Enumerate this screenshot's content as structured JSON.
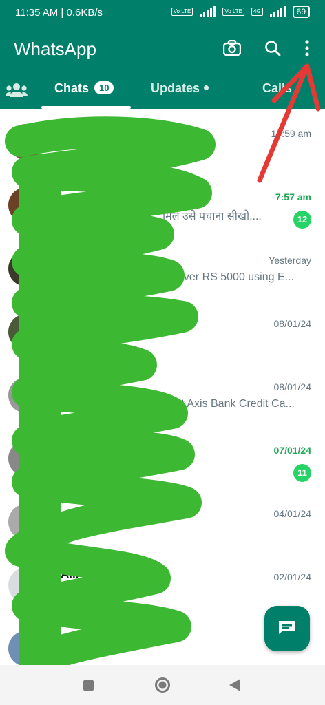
{
  "status_bar": {
    "time_speed": "11:35 AM | 0.6KB/s",
    "battery": "69",
    "net_tag_1": "Vo LTE",
    "net_tag_2": "Vo LTE",
    "net_4g": "4G"
  },
  "header": {
    "title": "WhatsApp"
  },
  "tabs": [
    {
      "label": "Chats",
      "count": "10"
    },
    {
      "label": "Updates"
    },
    {
      "label": "Calls"
    }
  ],
  "chats": [
    {
      "time": "10:59 am",
      "preview": "",
      "name": "",
      "unread": ""
    },
    {
      "time": "7:57 am",
      "preview": "मिले उसे पचाना सीखो,...",
      "unread": "12"
    },
    {
      "time": "Yesterday",
      "preview": "over RS 5000 using E...",
      "unread": ""
    },
    {
      "time": "08/01/24",
      "preview": "",
      "unread": ""
    },
    {
      "time": "08/01/24",
      "preview": "rt Axis Bank Credit Ca...",
      "unread": ""
    },
    {
      "time": "07/01/24",
      "preview": "",
      "unread": "11"
    },
    {
      "time": "04/01/24",
      "preview": "",
      "unread": ""
    },
    {
      "time": "02/01/24",
      "name": "A... ...put",
      "preview": "",
      "unread": ""
    }
  ],
  "colors": {
    "brand": "#00806a",
    "unread": "#25d366",
    "scribble": "#3db832",
    "annotation_arrow": "#e53935"
  }
}
